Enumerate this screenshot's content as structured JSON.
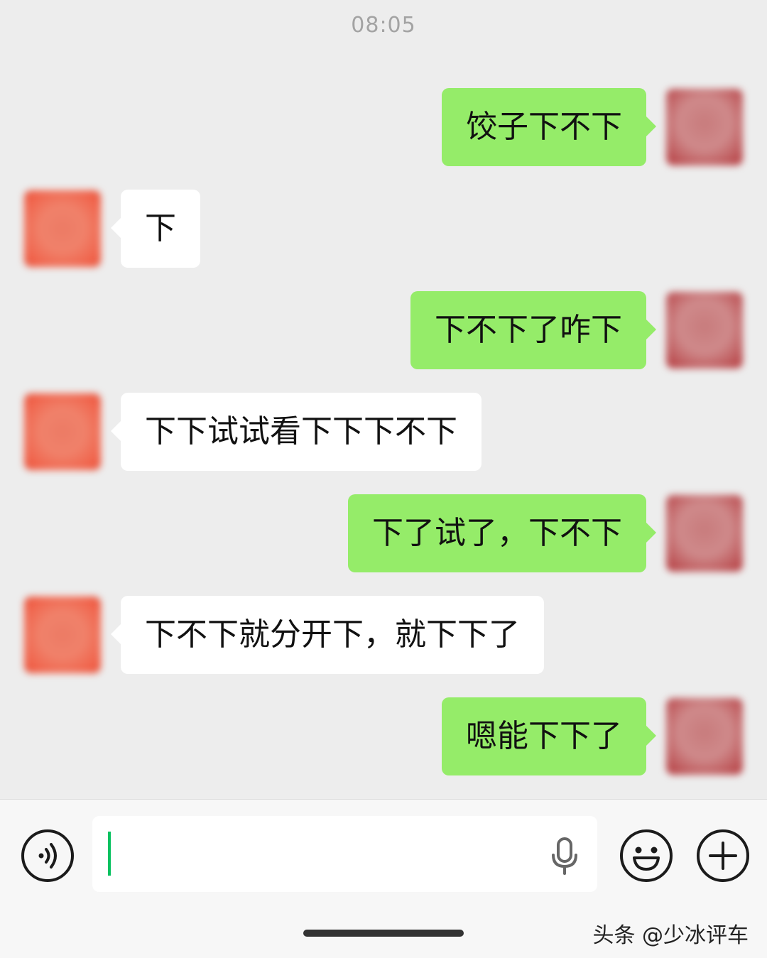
{
  "status": {
    "time": "08:05"
  },
  "messages": [
    {
      "side": "self",
      "text": "饺子下不下"
    },
    {
      "side": "peer",
      "text": "下"
    },
    {
      "side": "self",
      "text": "下不下了咋下"
    },
    {
      "side": "peer",
      "text": "下下试试看下下下不下"
    },
    {
      "side": "self",
      "text": "下了试了，下不下"
    },
    {
      "side": "peer",
      "text": "下不下就分开下，就下下了"
    },
    {
      "side": "self",
      "text": "嗯能下下了"
    }
  ],
  "input_bar": {
    "voice_icon": "voice-mode-icon",
    "mic_icon": "microphone-icon",
    "emoji_icon": "emoji-icon",
    "plus_icon": "plus-icon",
    "value": ""
  },
  "watermark": "头条 @少冰评车",
  "colors": {
    "self_bubble": "#95ec69",
    "peer_bubble": "#ffffff",
    "background": "#ededed",
    "caret": "#07c160"
  }
}
